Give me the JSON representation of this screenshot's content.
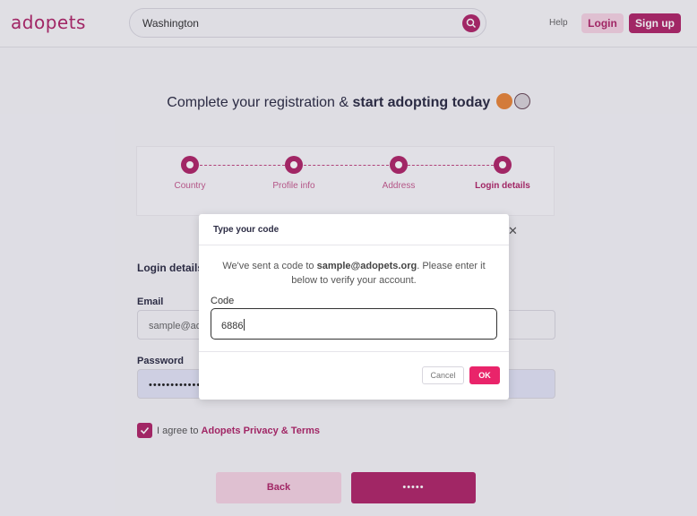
{
  "header": {
    "logo": "adopets",
    "search_value": "Washington",
    "help": "Help",
    "login": "Login",
    "signup": "Sign up"
  },
  "page": {
    "title_plain": "Complete your registration & ",
    "title_bold": "start adopting today"
  },
  "steps": [
    {
      "label": "Country",
      "icon": "globe-icon"
    },
    {
      "label": "Profile info",
      "icon": "user-icon"
    },
    {
      "label": "Address",
      "icon": "location-pin-icon"
    },
    {
      "label": "Login details",
      "icon": "key-icon"
    }
  ],
  "form": {
    "section_title": "Login details",
    "email_label": "Email",
    "email_value": "sample@ado",
    "password_label": "Password",
    "password_value": "•••••••••••••",
    "agree_text": "I agree to",
    "agree_link": "Adopets Privacy & Terms",
    "back": "Back",
    "next": "•••••"
  },
  "modal": {
    "title": "Type your code",
    "msg_pre": "We've sent a code to ",
    "msg_email": "sample@adopets.org",
    "msg_post": ". Please enter it below to verify your account.",
    "code_label": "Code",
    "code_value": "6886",
    "cancel": "Cancel",
    "ok": "OK"
  },
  "colors": {
    "brand": "#b0286a",
    "ok_button": "#e9246a"
  }
}
